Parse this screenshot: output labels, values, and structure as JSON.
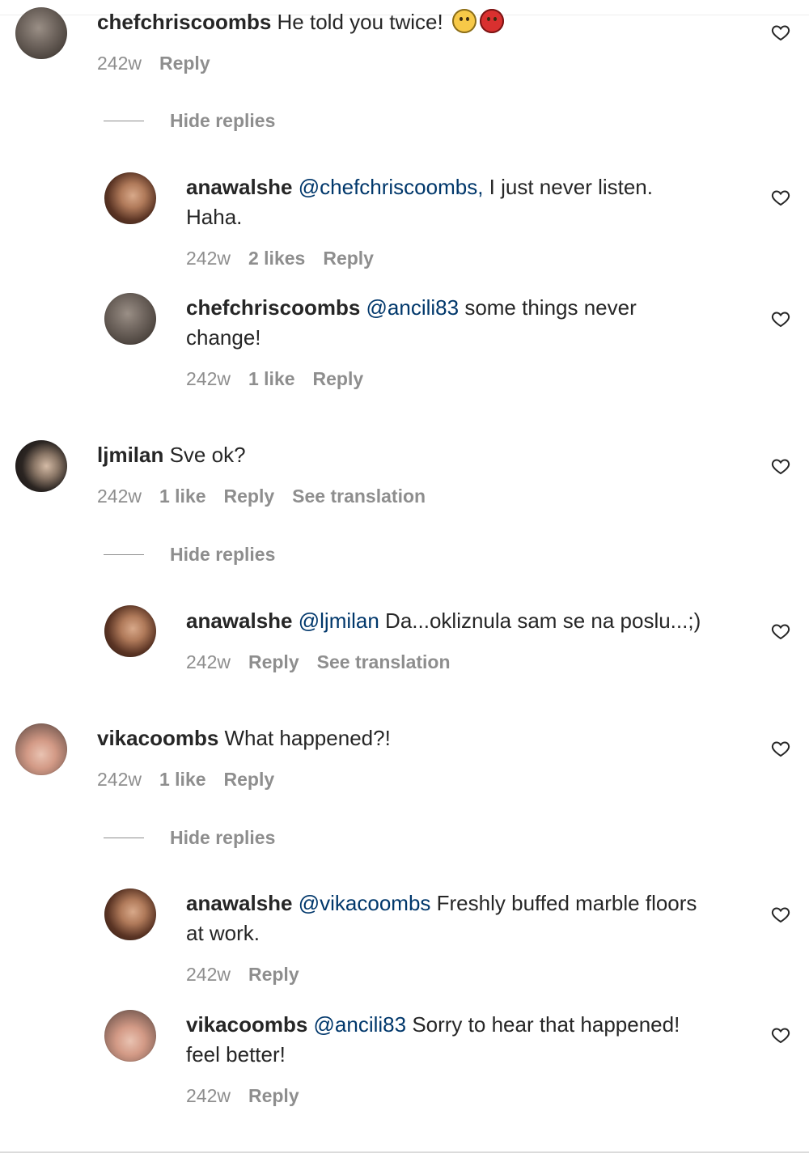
{
  "comments": [
    {
      "username": "chefchriscoombs",
      "text": "He told you twice!",
      "emoji": [
        "confused-face-emoji",
        "angry-face-emoji"
      ],
      "time": "242w",
      "reply_label": "Reply",
      "hide_replies": "Hide replies",
      "replies": [
        {
          "username": "anawalshe",
          "mention": "@chefchriscoombs,",
          "text_line1": " I just never listen.",
          "text_line2": "Haha.",
          "time": "242w",
          "likes": "2 likes",
          "reply_label": "Reply"
        },
        {
          "username": "chefchriscoombs",
          "mention": "@ancili83",
          "text_line1": " some things never",
          "text_line2": "change!",
          "time": "242w",
          "likes": "1 like",
          "reply_label": "Reply"
        }
      ]
    },
    {
      "username": "ljmilan",
      "text": " Sve ok?",
      "time": "242w",
      "likes": "1 like",
      "reply_label": "Reply",
      "translation_label": "See translation",
      "hide_replies": "Hide replies",
      "replies": [
        {
          "username": "anawalshe",
          "mention": "@ljmilan",
          "text_line1": " Da...okliznula sam se na poslu...;)",
          "time": "242w",
          "reply_label": "Reply",
          "translation_label": "See translation"
        }
      ]
    },
    {
      "username": "vikacoombs",
      "text": " What happened?!",
      "time": "242w",
      "likes": "1 like",
      "reply_label": "Reply",
      "hide_replies": "Hide replies",
      "replies": [
        {
          "username": "anawalshe",
          "mention": "@vikacoombs",
          "text_line1": " Freshly buffed marble floors",
          "text_line2": "at work.",
          "time": "242w",
          "reply_label": "Reply"
        },
        {
          "username": "vikacoombs",
          "mention": "@ancili83",
          "text_line1": " Sorry to hear that happened!",
          "text_line2": "feel better!",
          "time": "242w",
          "reply_label": "Reply"
        }
      ]
    }
  ],
  "colors": {
    "text": "#262626",
    "secondary": "#8e8e8e",
    "mention": "#00376b",
    "divider": "#dbdbdb"
  },
  "icons": {
    "like": "heart-outline-icon"
  }
}
